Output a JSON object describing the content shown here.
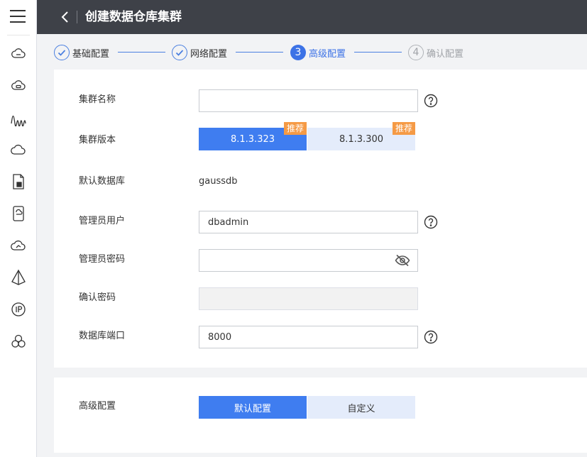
{
  "header": {
    "title": "创建数据仓库集群"
  },
  "sidebar": {
    "icons": [
      "cloud-server-icon",
      "cloud-disk-icon",
      "waveform-icon",
      "cloud-icon",
      "document-icon",
      "device-icon",
      "cloud-refresh-icon",
      "pyramid-icon",
      "ip-icon",
      "cluster-icon"
    ]
  },
  "steps": [
    {
      "label": "基础配置",
      "state": "done"
    },
    {
      "label": "网络配置",
      "state": "done"
    },
    {
      "number": "3",
      "label": "高级配置",
      "state": "active"
    },
    {
      "number": "4",
      "label": "确认配置",
      "state": "todo"
    }
  ],
  "form": {
    "cluster_name": {
      "label": "集群名称",
      "value": ""
    },
    "cluster_version": {
      "label": "集群版本",
      "options": [
        {
          "label": "8.1.3.323",
          "badge": "推荐",
          "selected": true
        },
        {
          "label": "8.1.3.300",
          "badge": "推荐",
          "selected": false
        }
      ]
    },
    "default_db": {
      "label": "默认数据库",
      "value": "gaussdb"
    },
    "admin_user": {
      "label": "管理员用户",
      "value": "dbadmin"
    },
    "admin_password": {
      "label": "管理员密码",
      "value": ""
    },
    "confirm_password": {
      "label": "确认密码",
      "value": ""
    },
    "db_port": {
      "label": "数据库端口",
      "value": "8000"
    }
  },
  "advanced": {
    "label": "高级配置",
    "options": [
      {
        "label": "默认配置",
        "selected": true
      },
      {
        "label": "自定义",
        "selected": false
      }
    ]
  },
  "colors": {
    "primary": "#3f7df0",
    "header_bg": "#3e4148",
    "badge": "#f59a45",
    "segment_off": "#e4ecfb"
  }
}
